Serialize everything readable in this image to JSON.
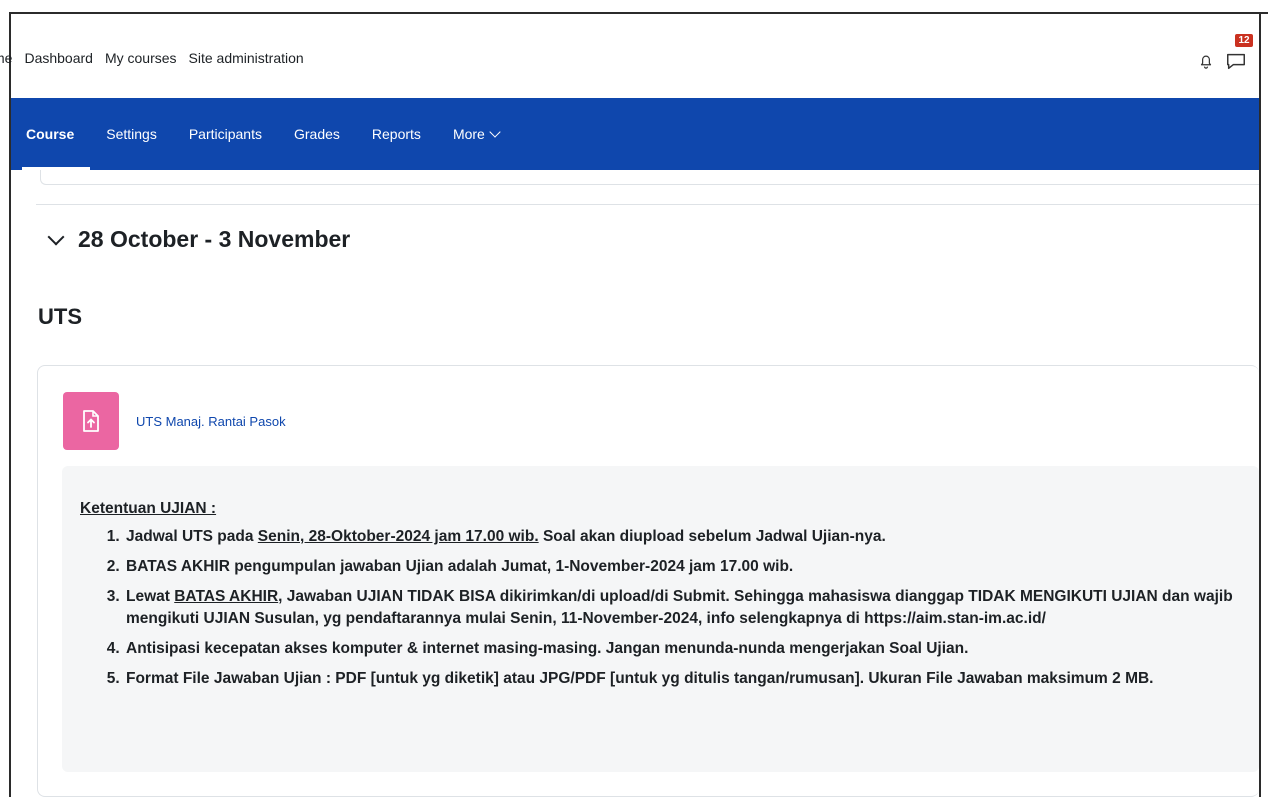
{
  "top_nav": {
    "items": [
      "me",
      "Dashboard",
      "My courses",
      "Site administration"
    ],
    "notification_badge": "12"
  },
  "secondary_nav": {
    "items": [
      "Course",
      "Settings",
      "Participants",
      "Grades",
      "Reports",
      "More"
    ],
    "active": "Course"
  },
  "section": {
    "title": "28 October - 3 November",
    "subtitle": "UTS"
  },
  "activity": {
    "name": "UTS Manaj. Rantai Pasok",
    "icon": "assignment-upload-icon",
    "icon_color": "#eb66a2"
  },
  "description": {
    "heading": "Ketentuan UJIAN :",
    "item1_pre": "Jadwal UTS pada ",
    "item1_date": "Senin, 28-Oktober-2024 jam 17.00 wib.",
    "item1_post": " Soal akan diupload sebelum Jadwal Ujian-nya.",
    "item2": "BATAS AKHIR pengumpulan jawaban Ujian adalah Jumat, 1-November-2024 jam 17.00 wib.",
    "item3_pre": "Lewat ",
    "item3_u": "BATAS AKHIR",
    "item3_post": ", Jawaban UJIAN TIDAK BISA dikirimkan/di upload/di Submit. Sehingga mahasiswa dianggap TIDAK MENGIKUTI UJIAN dan wajib mengikuti UJIAN Susulan, yg pendaftarannya mulai Senin, 11-November-2024, info selengkapnya di https://aim.stan-im.ac.id/",
    "item4": "Antisipasi kecepatan akses komputer & internet masing-masing. Jangan menunda-nunda mengerjakan Soal Ujian.",
    "item5": "Format File Jawaban Ujian : PDF [untuk yg diketik] atau JPG/PDF [untuk yg ditulis tangan/rumusan]. Ukuran File Jawaban maksimum 2 MB."
  },
  "colors": {
    "primary": "#0f47ad",
    "badge": "#ca3120"
  }
}
